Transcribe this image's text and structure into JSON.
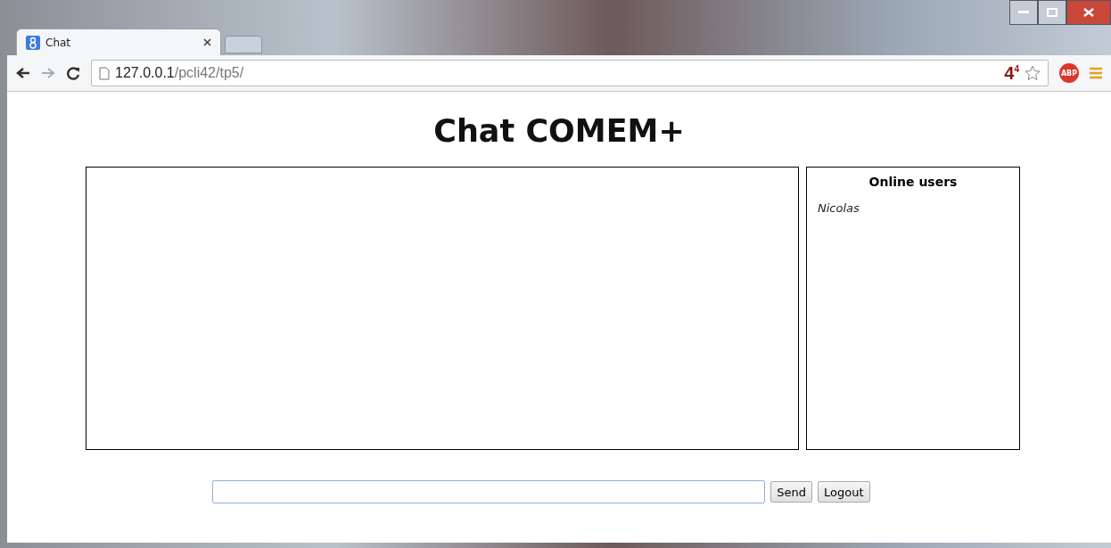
{
  "browser": {
    "tab": {
      "title": "Chat"
    },
    "address": {
      "host": "127.0.0.1",
      "path": "/pcli42/tp5/"
    },
    "badge": "4$^{4}$",
    "extension": "ABP"
  },
  "page": {
    "title": "Chat COMEM+",
    "users_panel": {
      "heading": "Online users",
      "users": [
        "Nicolas"
      ]
    },
    "buttons": [
      "Send",
      "Logout"
    ]
  }
}
